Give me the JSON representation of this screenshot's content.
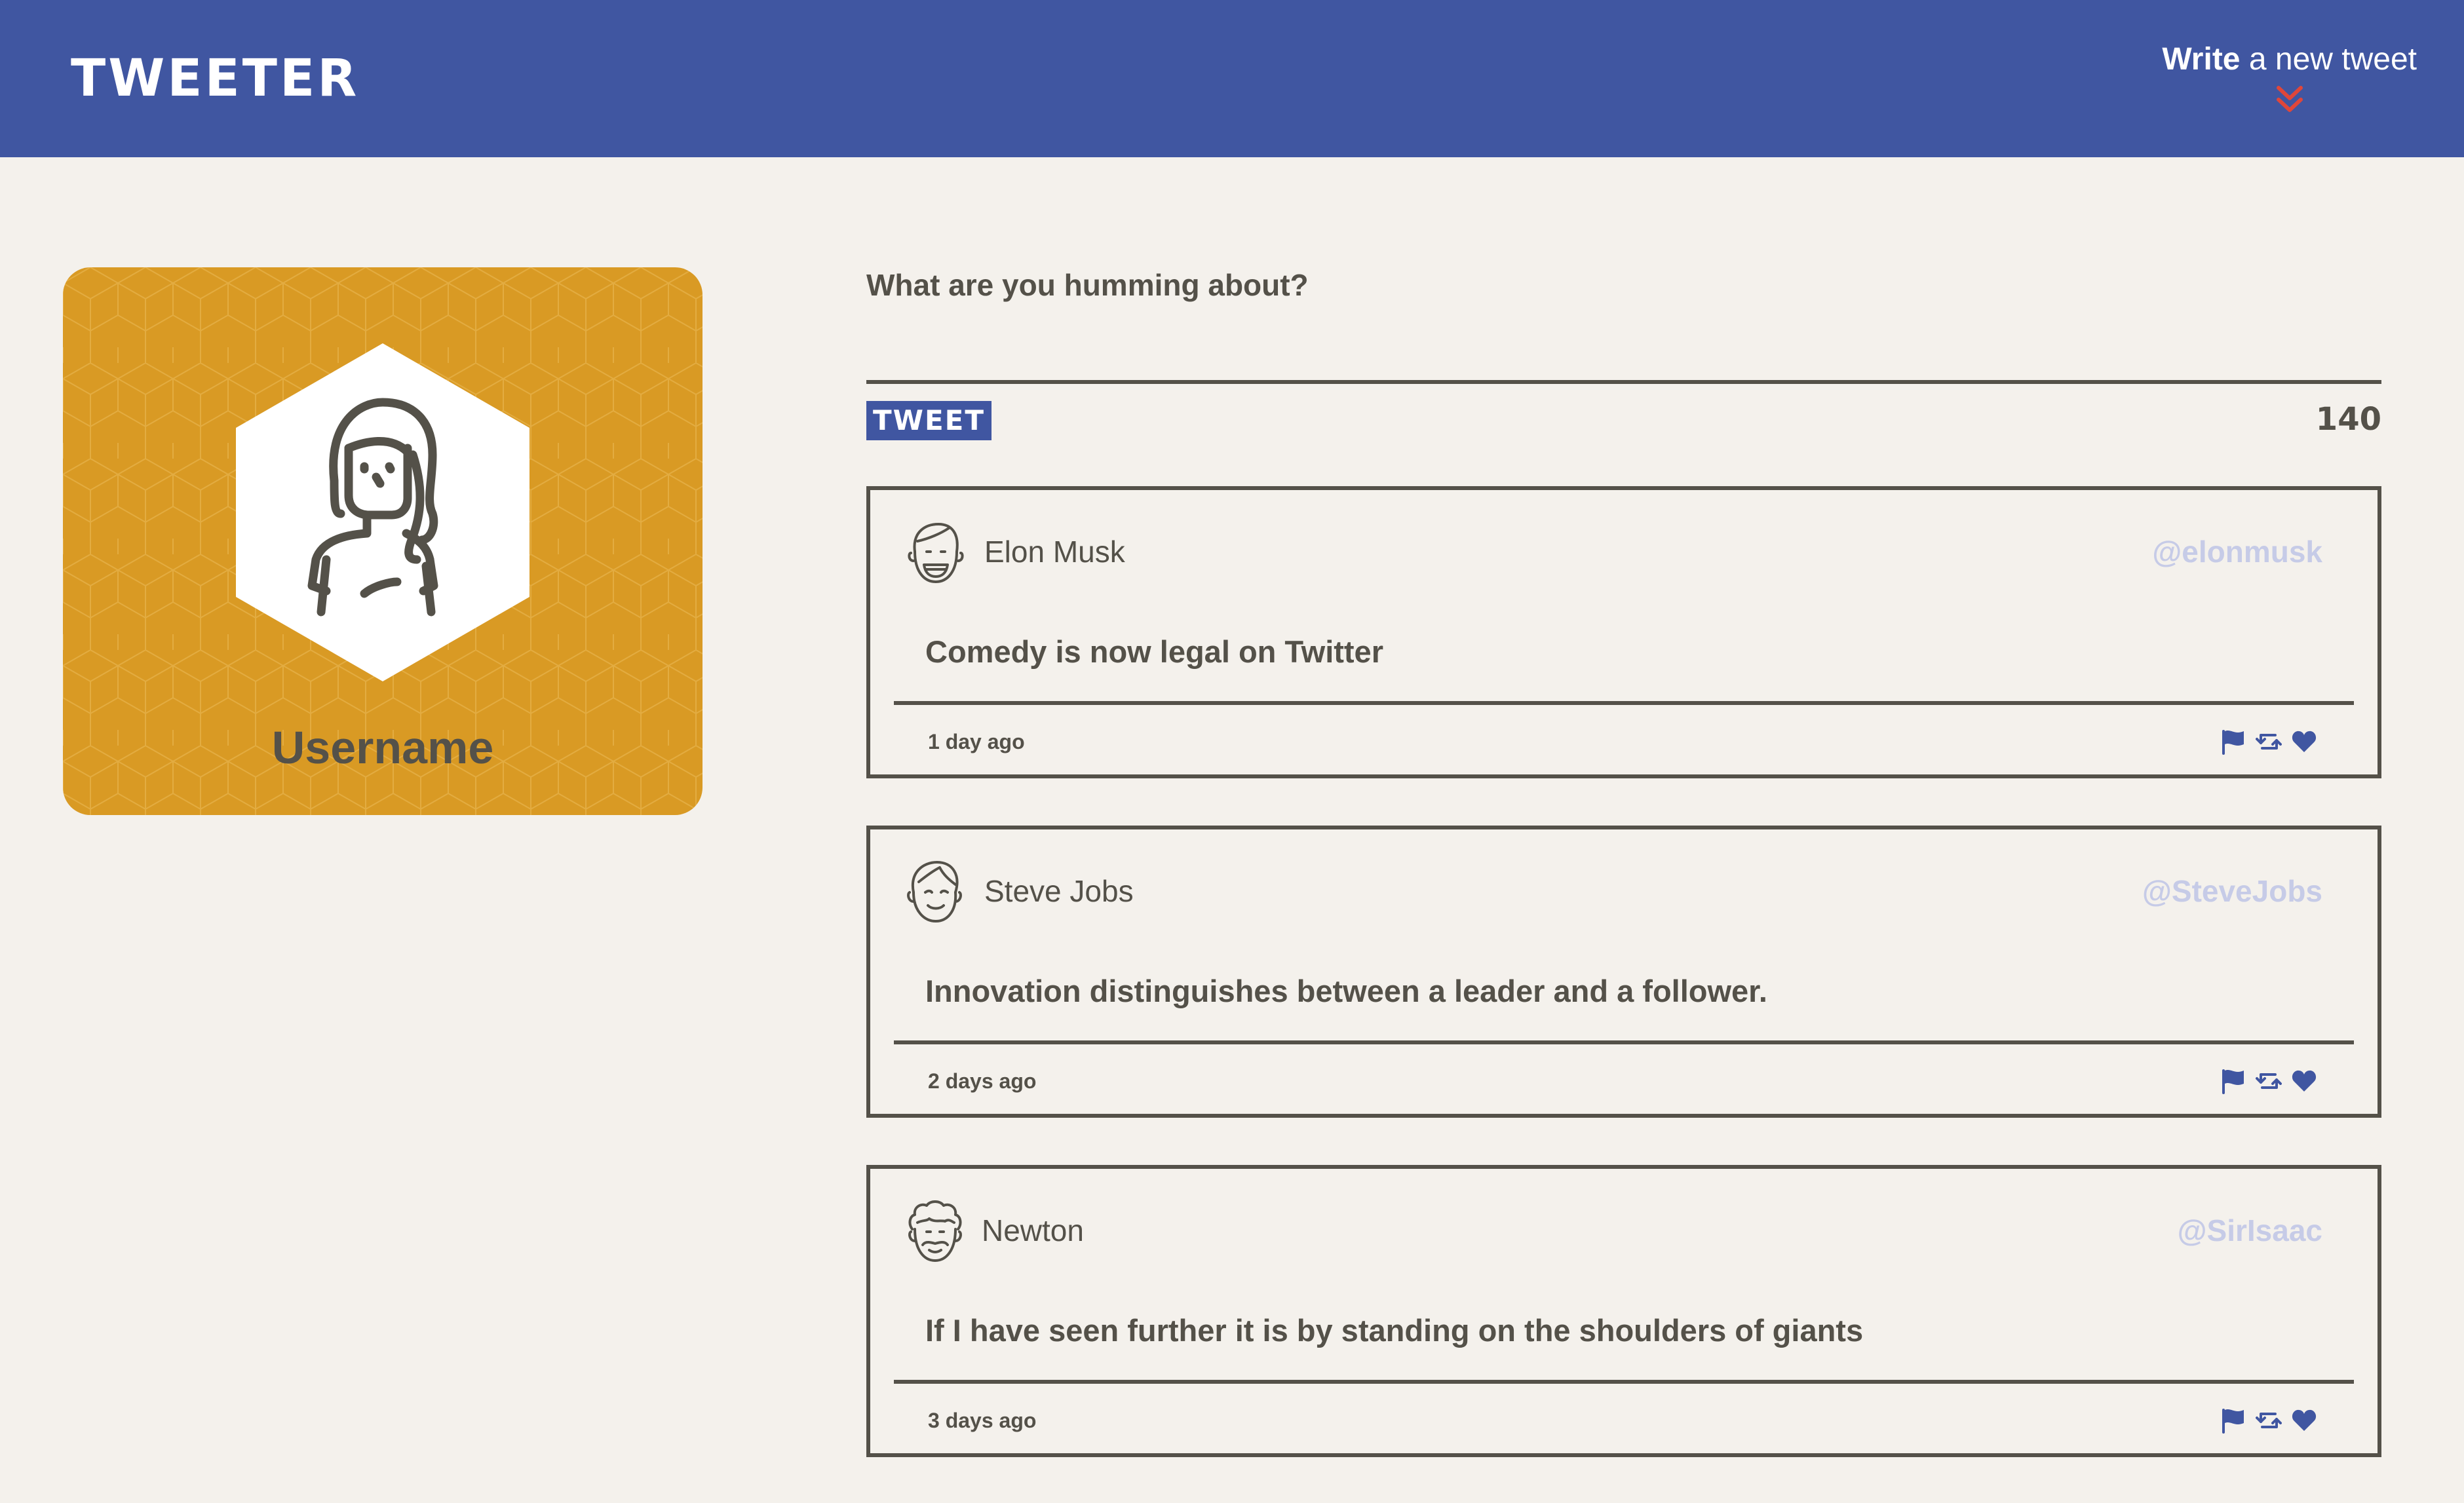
{
  "nav": {
    "brand": "TWEETER",
    "compose_strong": "Write",
    "compose_rest": "a new tweet",
    "compose_arrow_icon": "double-chevron-down-icon"
  },
  "profile": {
    "username": "Username",
    "avatar_icon": "woman-avatar-icon"
  },
  "composer": {
    "prompt": "What are you humming about?",
    "placeholder": "",
    "button_label": "TWEET",
    "counter": "140"
  },
  "tweets": [
    {
      "name": "Elon Musk",
      "handle": "@elonmusk",
      "text": "Comedy is now legal on Twitter",
      "time": "1 day ago",
      "avatar_icon": "smiling-man-avatar-icon"
    },
    {
      "name": "Steve Jobs",
      "handle": "@SteveJobs",
      "text": "Innovation distinguishes between a leader and a follower.",
      "time": "2 days ago",
      "avatar_icon": "man-avatar-icon"
    },
    {
      "name": "Newton",
      "handle": "@SirIsaac",
      "text": "If I have seen further it is by standing on the shoulders of giants",
      "time": "3 days ago",
      "avatar_icon": "curly-hair-man-avatar-icon"
    }
  ],
  "actions": {
    "flag_icon": "flag-icon",
    "retweet_icon": "retweet-icon",
    "like_icon": "heart-icon"
  },
  "colors": {
    "nav_bg": "#4056a1",
    "page_bg": "#f4f1ec",
    "card_bg": "#d99a24",
    "text": "#545149",
    "handle": "#c6cbe7",
    "accent_red": "#e0463a",
    "icon_blue": "#4056a1"
  }
}
